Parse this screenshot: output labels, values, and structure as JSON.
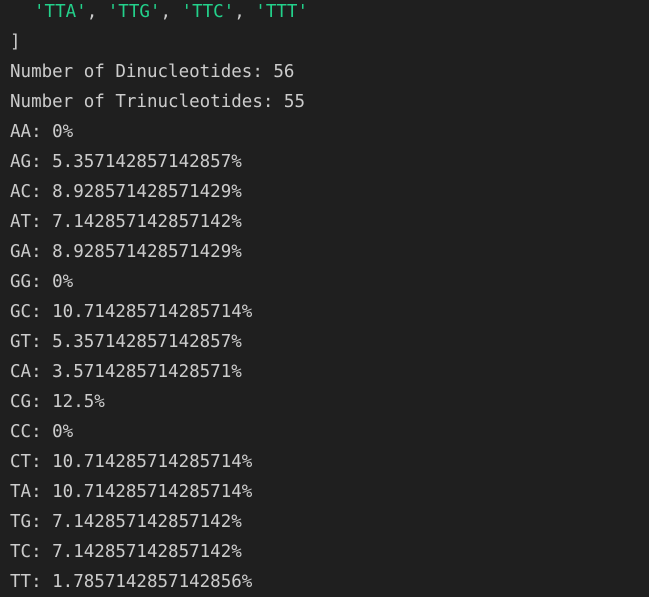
{
  "terminal": {
    "array_tail": {
      "items": [
        "'TTA'",
        "'TTG'",
        "'TTC'",
        "'TTT'"
      ],
      "separator": ", "
    },
    "closing_bracket": "]",
    "lines": [
      "Number of Dinucleotides: 56",
      "Number of Trinucleotides: 55",
      "AA: 0%",
      "AG: 5.357142857142857%",
      "AC: 8.928571428571429%",
      "AT: 7.142857142857142%",
      "GA: 8.928571428571429%",
      "GG: 0%",
      "GC: 10.714285714285714%",
      "GT: 5.357142857142857%",
      "CA: 3.571428571428571%",
      "CG: 12.5%",
      "CC: 0%",
      "CT: 10.714285714285714%",
      "TA: 10.714285714285714%",
      "TG: 7.142857142857142%",
      "TC: 7.142857142857142%",
      "TT: 1.7857142857142856%"
    ],
    "colors": {
      "background": "#1f1f1f",
      "text": "#cccccc",
      "string": "#23d18b"
    }
  }
}
